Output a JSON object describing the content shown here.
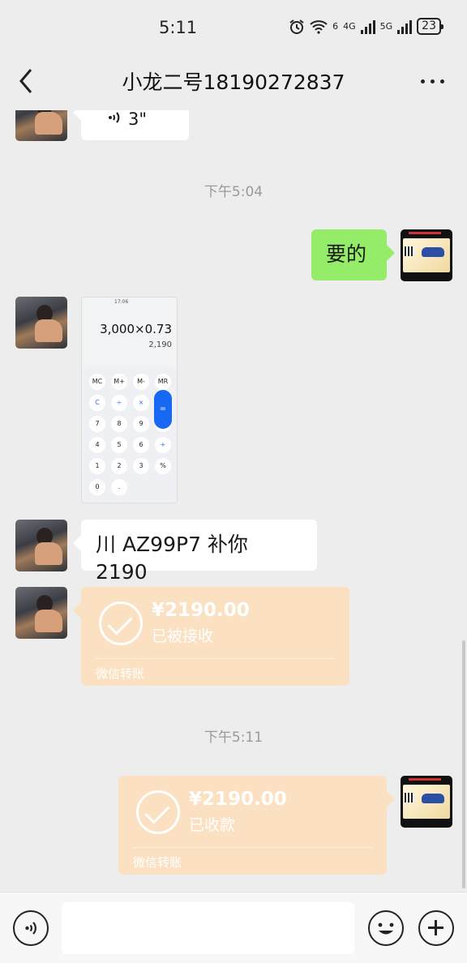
{
  "status_bar": {
    "time": "5:11",
    "battery": "23",
    "net1": "4G",
    "net2": "5G",
    "wifi_badge": "6"
  },
  "header": {
    "title": "小龙二号18190272837"
  },
  "messages": {
    "voice_duration": "3\"",
    "time_1": "下午5:04",
    "out_text": "要的",
    "plate_text": "川 AZ99P7 补你 2190",
    "time_2": "下午5:11"
  },
  "calculator_image": {
    "status_text": "17:06",
    "expression": "3,000×0.73",
    "result": "2,190",
    "keys": [
      "MC",
      "M+",
      "M-",
      "MR",
      "C",
      "÷",
      "×",
      "⌫",
      "7",
      "8",
      "9",
      "−",
      "4",
      "5",
      "6",
      "+",
      "1",
      "2",
      "3",
      "%",
      "0",
      "."
    ],
    "equals": "="
  },
  "transfer_received": {
    "amount": "¥2190.00",
    "status": "已被接收",
    "footer": "微信转账"
  },
  "transfer_sent": {
    "amount": "¥2190.00",
    "status": "已收款",
    "footer": "微信转账"
  },
  "input_bar": {
    "placeholder": ""
  }
}
